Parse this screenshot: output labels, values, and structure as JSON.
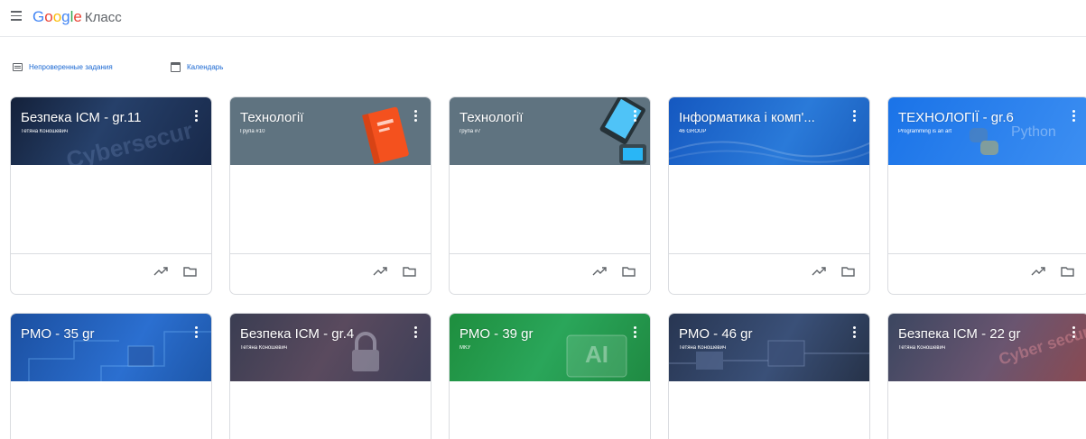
{
  "app": {
    "logo_google": [
      "G",
      "o",
      "o",
      "g",
      "l",
      "e"
    ],
    "logo_product": "Класс"
  },
  "toolbar": {
    "todo_label": "Непроверенные задания",
    "calendar_label": "Календарь"
  },
  "courses": [
    {
      "title": "Безпека ІСМ - gr.11",
      "subtitle": "Тетяна Коношевич",
      "theme": "cyber"
    },
    {
      "title": "Технології",
      "subtitle": "Група #10",
      "theme": "book"
    },
    {
      "title": "Технології",
      "subtitle": "група #7",
      "theme": "tablet"
    },
    {
      "title": "Інформатика і комп'...",
      "subtitle": "46 GROUP",
      "theme": "info"
    },
    {
      "title": "ТЕХНОЛОГІЇ - gr.6",
      "subtitle": "Programming is an art",
      "theme": "python"
    },
    {
      "title": "РМО - 35 gr",
      "subtitle": "",
      "theme": "circuit"
    },
    {
      "title": "Безпека ІСМ - gr.4",
      "subtitle": "Тетяна Коношевич",
      "theme": "lock"
    },
    {
      "title": "РМО - 39 gr",
      "subtitle": "МКУ",
      "theme": "ai"
    },
    {
      "title": "РМО - 46 gr",
      "subtitle": "Тетяна Коношевич",
      "theme": "board"
    },
    {
      "title": "Безпека ІСМ - 22 gr",
      "subtitle": "Тетяна Коношевич",
      "theme": "security"
    }
  ],
  "banner_text": {
    "cyber": "Cybersecur",
    "python": "Python",
    "ai": "AI",
    "security": "Cyber security"
  },
  "colors": {
    "accent": "#1967d2",
    "border": "#dadce0",
    "icon_gray": "#5f6368"
  }
}
